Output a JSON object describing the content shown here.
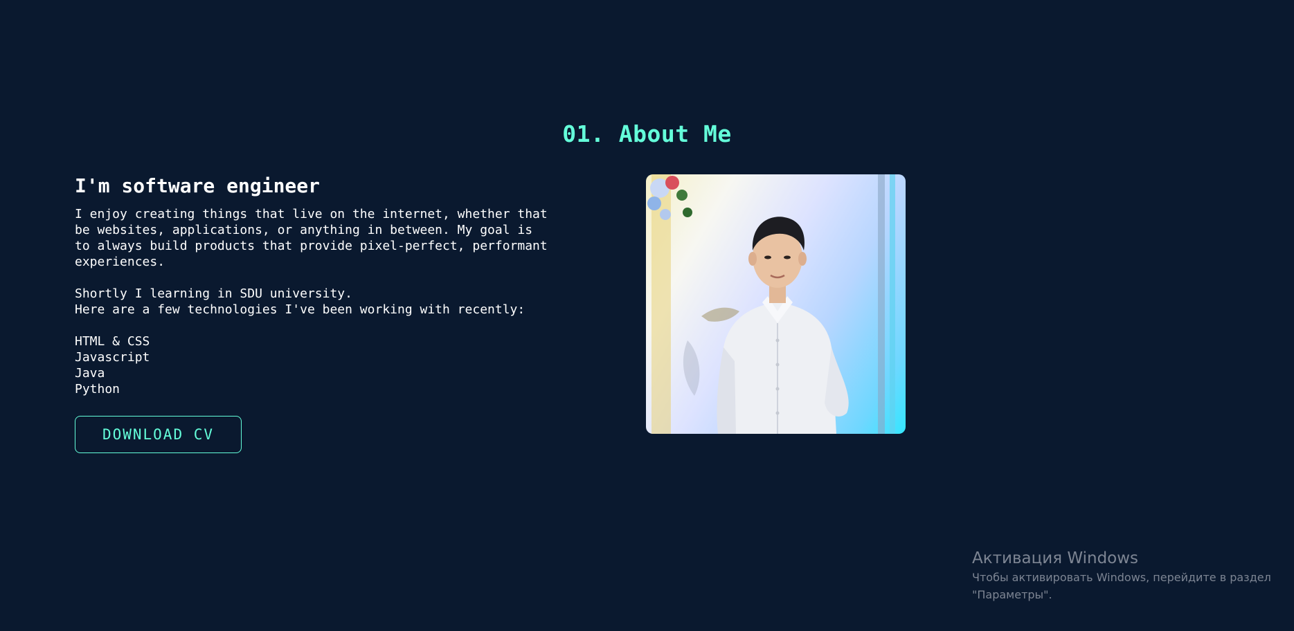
{
  "about": {
    "section_title": "01. About Me",
    "heading": "I'm software engineer",
    "paragraph_1": "I enjoy creating things that live on the internet, whether that\nbe websites, applications, or anything in between. My goal is\nto always build products that provide pixel-perfect, performant\nexperiences.",
    "paragraph_2": "Shortly I learning in SDU university.\nHere are a few technologies I've been working with recently:",
    "technologies": [
      "HTML & CSS",
      "Javascript",
      "Java",
      "Python"
    ],
    "download_label": "DOWNLOAD CV"
  },
  "photo": {
    "subject": "portrait-photo"
  },
  "windows_activation": {
    "title": "Активация Windows",
    "line_1": "Чтобы активировать Windows, перейдите в раздел",
    "line_2": "\"Параметры\"."
  },
  "colors": {
    "background": "#0a192f",
    "accent": "#64ffda",
    "text": "#ffffff"
  }
}
